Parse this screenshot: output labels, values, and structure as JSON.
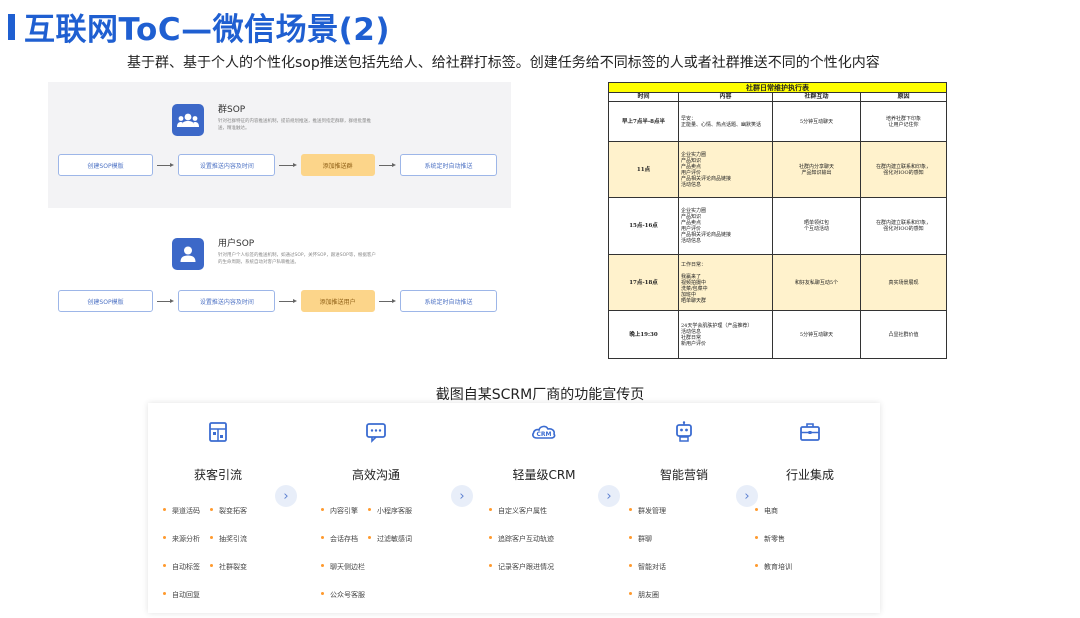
{
  "header": {
    "title": "互联网ToC—微信场景(2)",
    "subtitle": "基于群、基于个人的个性化sop推送包括先给人、给社群打标签。创建任务给不同标签的人或者社群推送不同的个性化内容"
  },
  "colors": {
    "accent": "#1f5fd1",
    "highlight": "#fcd58a",
    "table_caption": "#ffff00",
    "table_row_highlight": "#fff2cc",
    "bullet": "#ff9a2e"
  },
  "sop_group": {
    "name": "群SOP",
    "desc": "针对社群特征的内容推送机制，提前规划推送，推送到指定群聊，群组批量推送，精准触达。",
    "steps": [
      "创建SOP模版",
      "设置推送内容及时间",
      "添加推送群",
      "系统定时自动推送"
    ]
  },
  "sop_user": {
    "name": "用户SOP",
    "desc": "针对用户个人标签的推送机制，如通过SOP，关怀SOP，跟进SOP等，根据客户的生命周期，系统自动对客户私聊推送。",
    "steps": [
      "创建SOP模版",
      "设置推送内容及时间",
      "添加推送用户",
      "系统定时自动推送"
    ]
  },
  "schedule": {
    "caption": "社群日常维护执行表",
    "headers": [
      "时间",
      "内容",
      "社群互动",
      "原因"
    ],
    "rows": [
      {
        "time": "早上7点半-8点半",
        "content": "早安：\n正能量、心情、热点话题、幽默笑话",
        "interaction": "5分钟互动聊天",
        "reason": "培养社群下印象\n让用户记住你"
      },
      {
        "time": "11点",
        "content": "企业实力圈\n产品知识\n产品卖点\n用户评价\n产品相关评论商品链接\n活动信息",
        "interaction": "社群内分享聊天\n产品知识输出",
        "reason": "在群内建立联系和印象，\n强化对IOO的感知"
      },
      {
        "time": "15点-16点",
        "content": "企业实力圈\n产品知识\n产品卖点\n用户评价\n产品相关评论商品链接\n活动信息",
        "interaction": "晒单领红包\n个互动活动",
        "reason": "在群内建立联系和印象，\n强化对IOO的感知"
      },
      {
        "time": "17点-18点",
        "content": "工作日常：\n\n我赢来了\n视频拍摄中\n洗菜/包菜中\n加班中\n晒单聊天群",
        "interaction": "和好友私聊互动5个",
        "reason": "真实场景展现"
      },
      {
        "time": "晚上19:30",
        "content": "24天学会肌肤护理（产品推荐）\n活动信息\n社群日常\n新用户评价",
        "interaction": "5分钟互动聊天",
        "reason": "凸显社群价值"
      }
    ]
  },
  "scrm": {
    "caption": "截图自某SCRM厂商的功能宣传页",
    "columns": [
      {
        "icon": "acquisition-icon",
        "title": "获客引流",
        "rows": [
          [
            "渠道活码",
            "裂变拓客"
          ],
          [
            "来源分析",
            "抽奖引流"
          ],
          [
            "自动标签",
            "社群裂变"
          ],
          [
            "自动回复"
          ]
        ]
      },
      {
        "icon": "chat-bubble-icon",
        "title": "高效沟通",
        "rows": [
          [
            "内容引擎",
            "小程序客服"
          ],
          [
            "会话存档",
            "过滤敏感词"
          ],
          [
            "聊天侧边栏"
          ],
          [
            "公众号客服"
          ]
        ]
      },
      {
        "icon": "crm-cloud-icon",
        "title": "轻量级CRM",
        "rows": [
          [
            "自定义客户属性"
          ],
          [
            "追踪客户互动轨迹"
          ],
          [
            "记录客户跟进情况"
          ]
        ]
      },
      {
        "icon": "robot-icon",
        "title": "智能营销",
        "rows": [
          [
            "群发管理"
          ],
          [
            "群聊"
          ],
          [
            "智能对话"
          ],
          [
            "朋友圈"
          ]
        ]
      },
      {
        "icon": "briefcase-icon",
        "title": "行业集成",
        "rows": [
          [
            "电商"
          ],
          [
            "新零售"
          ],
          [
            "教育培训"
          ]
        ]
      }
    ]
  }
}
